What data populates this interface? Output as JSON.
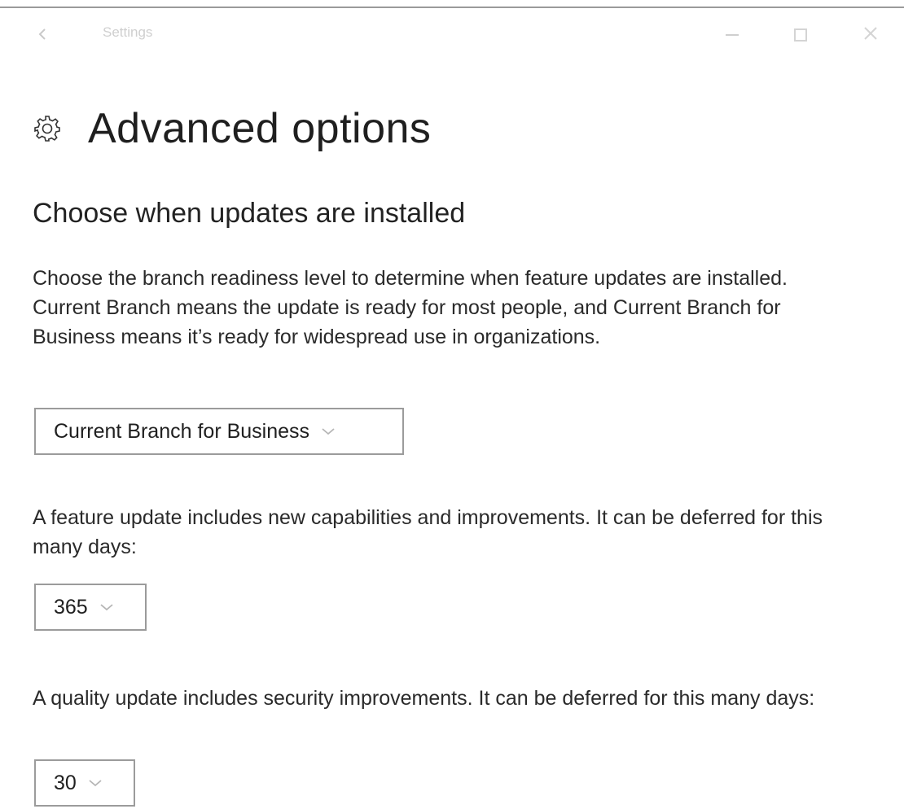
{
  "window": {
    "title": "Settings",
    "icons": {
      "back": "back-arrow-icon",
      "minimize": "minimize-icon",
      "maximize": "maximize-icon",
      "close": "close-icon"
    }
  },
  "header": {
    "icon": "gear-icon",
    "title": "Advanced options"
  },
  "section": {
    "heading": "Choose when updates are installed",
    "branch_description": "Choose the branch readiness level to determine when feature updates are installed. Current Branch means the update is ready for most people, and Current Branch for Business means it’s ready for widespread use in organizations.",
    "branch_select": {
      "value": "Current Branch for Business"
    },
    "feature_description": "A feature update includes new capabilities and improvements. It can be deferred for this many days:",
    "feature_select": {
      "value": "365"
    },
    "quality_description": "A quality update includes security improvements. It can be deferred for this many days:",
    "quality_select": {
      "value": "30"
    }
  },
  "colors": {
    "text": "#1f1f1f",
    "border": "#9b9b9b",
    "titlebar_faded": "#cfcfcf",
    "background": "#ffffff"
  }
}
